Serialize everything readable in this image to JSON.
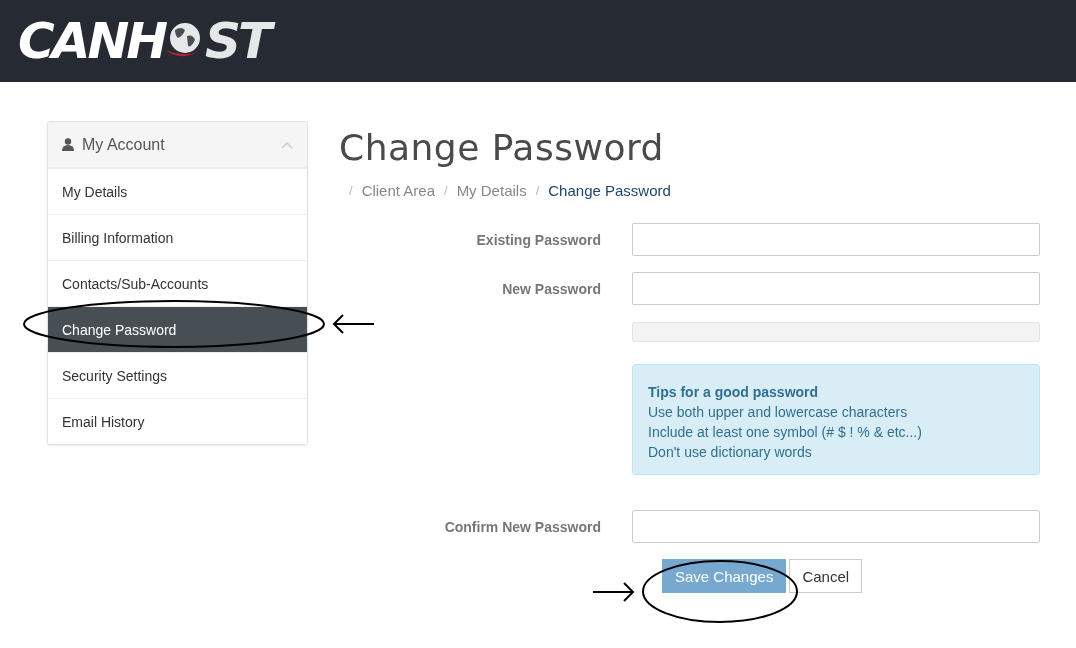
{
  "logo": {
    "text_before": "CANH",
    "text_after": "ST"
  },
  "sidebar": {
    "title": "My Account",
    "expanded": true,
    "items": [
      {
        "label": "My Details",
        "selected": false
      },
      {
        "label": "Billing Information",
        "selected": false
      },
      {
        "label": "Contacts/Sub-Accounts",
        "selected": false
      },
      {
        "label": "Change Password",
        "selected": true
      },
      {
        "label": "Security Settings",
        "selected": false
      },
      {
        "label": "Email History",
        "selected": false
      }
    ]
  },
  "page_title": "Change Password",
  "breadcrumb": [
    {
      "separator": "/",
      "label": "Client Area",
      "current": false
    },
    {
      "separator": "/",
      "label": "My Details",
      "current": false
    },
    {
      "separator": "/",
      "label": "Change Password",
      "current": true
    }
  ],
  "form": {
    "existing_password": {
      "label": "Existing Password"
    },
    "new_password": {
      "label": "New Password"
    },
    "tips": {
      "title": "Tips for a good password",
      "lines": [
        "Use both upper and lowercase characters",
        "Include at least one symbol (# $ ! % & etc...)",
        "Don't use dictionary words"
      ]
    },
    "confirm_password": {
      "label": "Confirm New Password"
    },
    "buttons": [
      {
        "label": "Save Changes",
        "kind": "primary"
      },
      {
        "label": "Cancel",
        "kind": "default"
      }
    ]
  }
}
